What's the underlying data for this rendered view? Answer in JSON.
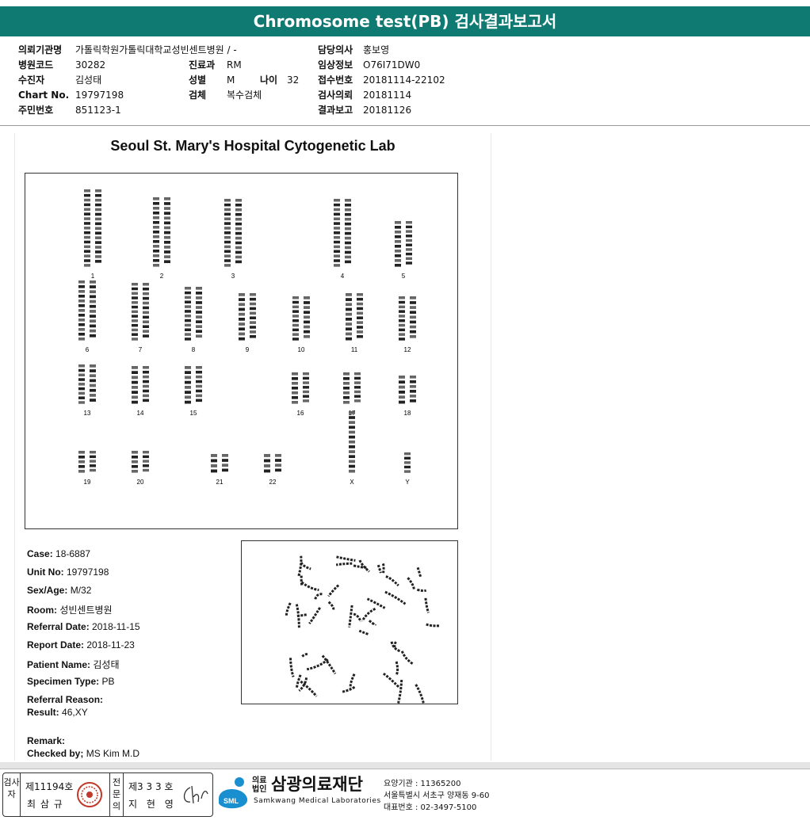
{
  "title": "Chromosome test(PB) 검사결과보고서",
  "header": {
    "left": [
      {
        "k": "의뢰기관명",
        "v": "가톨릭학원가톨릭대학교성빈센트병원 / -"
      },
      {
        "k": "병원코드",
        "v": "30282"
      },
      {
        "k": "수진자",
        "v": "김성태"
      },
      {
        "k": "Chart No.",
        "v": "19797198"
      },
      {
        "k": "주민번호",
        "v": "851123-1"
      }
    ],
    "mid": [
      {
        "k": "진료과",
        "v": "RM"
      },
      {
        "k": "성별",
        "v": "M"
      },
      {
        "k": "검체",
        "v": "복수검체"
      }
    ],
    "age_k": "나이",
    "age_v": "32",
    "right": [
      {
        "k": "담당의사",
        "v": "홍보영"
      },
      {
        "k": "임상정보",
        "v": "O76I71DW0"
      },
      {
        "k": "접수번호",
        "v": "20181114-22102"
      },
      {
        "k": "검사의뢰",
        "v": "20181114"
      },
      {
        "k": "결과보고",
        "v": "20181126"
      }
    ]
  },
  "lab_title": "Seoul St. Mary's Hospital Cytogenetic Lab",
  "chromosome_labels": [
    "1",
    "2",
    "3",
    "4",
    "5",
    "6",
    "7",
    "8",
    "9",
    "10",
    "11",
    "12",
    "13",
    "14",
    "15",
    "16",
    "17",
    "18",
    "19",
    "20",
    "21",
    "22",
    "X",
    "Y"
  ],
  "fields": [
    {
      "k": "Case:",
      "v": "18-6887"
    },
    {
      "k": "Unit No:",
      "v": "19797198"
    },
    {
      "k": "Sex/Age:",
      "v": "M/32"
    },
    {
      "k": "Room:",
      "v": "성빈센트병원"
    },
    {
      "k": "Referral Date:",
      "v": "2018-11-15"
    },
    {
      "k": "Report Date:",
      "v": "2018-11-23"
    },
    {
      "k": "Patient Name:",
      "v": "김성태"
    },
    {
      "k": "Specimen Type:",
      "v": "PB"
    },
    {
      "k": "Referral Reason:",
      "v": ""
    },
    {
      "k": "Result:",
      "v": "46,XY"
    },
    {
      "k": "Remark:",
      "v": ""
    },
    {
      "k": "Checked by;",
      "v": "MS Kim  M.D"
    }
  ],
  "footer": {
    "tester_label": "검사자",
    "tester_no": "제11194호",
    "tester_name": "최 삼 규",
    "specialist_label": "전문의",
    "specialist_no": "제3 3 3 호",
    "specialist_name": "지 현 영",
    "org_prefix": "의료법인",
    "org_name": "삼광의료재단",
    "org_en": "Samkwang Medical Laboratories",
    "logo_text": "SML",
    "code": "요양기관 : 11365200",
    "address": "서울특별시 서초구 양재동 9-60",
    "phone": "대표번호 : 02-3497-5100"
  }
}
